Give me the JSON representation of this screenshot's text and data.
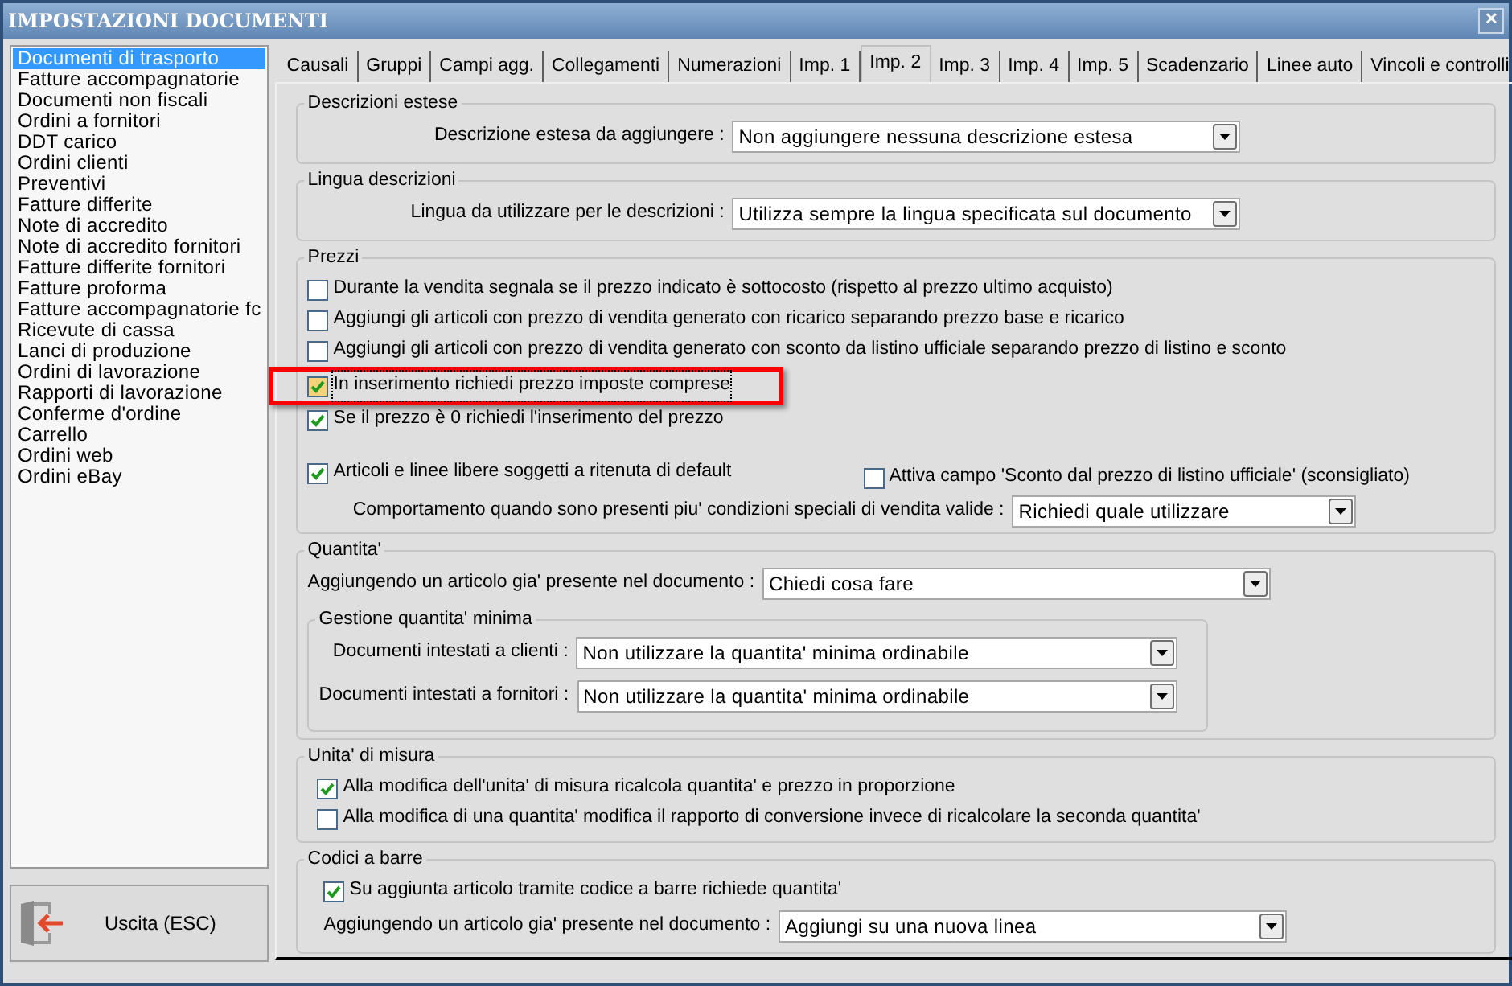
{
  "window": {
    "title": "IMPOSTAZIONI DOCUMENTI",
    "close": "✕"
  },
  "sidebar": {
    "items": [
      {
        "label": "Documenti di trasporto",
        "selected": true
      },
      {
        "label": "Fatture accompagnatorie",
        "selected": false
      },
      {
        "label": "Documenti non fiscali",
        "selected": false
      },
      {
        "label": "Ordini a fornitori",
        "selected": false
      },
      {
        "label": "DDT carico",
        "selected": false
      },
      {
        "label": "Ordini clienti",
        "selected": false
      },
      {
        "label": "Preventivi",
        "selected": false
      },
      {
        "label": "Fatture differite",
        "selected": false
      },
      {
        "label": "Note di accredito",
        "selected": false
      },
      {
        "label": "Note di accredito fornitori",
        "selected": false
      },
      {
        "label": "Fatture differite fornitori",
        "selected": false
      },
      {
        "label": "Fatture proforma",
        "selected": false
      },
      {
        "label": "Fatture accompagnatorie fc",
        "selected": false
      },
      {
        "label": "Ricevute di cassa",
        "selected": false
      },
      {
        "label": "Lanci di produzione",
        "selected": false
      },
      {
        "label": "Ordini di lavorazione",
        "selected": false
      },
      {
        "label": "Rapporti di lavorazione",
        "selected": false
      },
      {
        "label": "Conferme d'ordine",
        "selected": false
      },
      {
        "label": "Carrello",
        "selected": false
      },
      {
        "label": "Ordini web",
        "selected": false
      },
      {
        "label": "Ordini eBay",
        "selected": false
      }
    ]
  },
  "exit_button": {
    "label": "Uscita (ESC)"
  },
  "tabs": [
    {
      "label": "Causali",
      "selected": false
    },
    {
      "label": "Gruppi",
      "selected": false
    },
    {
      "label": "Campi agg.",
      "selected": false
    },
    {
      "label": "Collegamenti",
      "selected": false
    },
    {
      "label": "Numerazioni",
      "selected": false
    },
    {
      "label": "Imp. 1",
      "selected": false
    },
    {
      "label": "Imp. 2",
      "selected": true
    },
    {
      "label": "Imp. 3",
      "selected": false
    },
    {
      "label": "Imp. 4",
      "selected": false
    },
    {
      "label": "Imp. 5",
      "selected": false
    },
    {
      "label": "Scadenzario",
      "selected": false
    },
    {
      "label": "Linee auto",
      "selected": false
    },
    {
      "label": "Vincoli e controlli",
      "selected": false
    }
  ],
  "descrizioni": {
    "title": "Descrizioni estese",
    "label": "Descrizione estesa da aggiungere :",
    "value": "Non aggiungere nessuna descrizione estesa"
  },
  "lingua": {
    "title": "Lingua descrizioni",
    "label": "Lingua da utilizzare per le descrizioni :",
    "value": "Utilizza sempre la lingua specificata sul documento"
  },
  "prezzi": {
    "title": "Prezzi",
    "checks": [
      {
        "label": "Durante la vendita segnala se il prezzo indicato è sottocosto (rispetto al prezzo ultimo acquisto)",
        "checked": false,
        "highlighted": false
      },
      {
        "label": "Aggiungi gli articoli con prezzo di vendita generato con ricarico separando prezzo base e ricarico",
        "checked": false,
        "highlighted": false
      },
      {
        "label": "Aggiungi gli articoli con prezzo di vendita generato con sconto da listino ufficiale separando prezzo di listino e sconto",
        "checked": false,
        "highlighted": false
      },
      {
        "label": "In inserimento richiedi prezzo imposte comprese",
        "checked": true,
        "highlighted": true
      },
      {
        "label": "Se il prezzo è 0 richiedi l'inserimento del prezzo",
        "checked": true,
        "highlighted": false
      }
    ],
    "ritenuta": {
      "label": "Articoli e linee libere soggetti a ritenuta di default",
      "checked": true
    },
    "sconto": {
      "label": "Attiva campo 'Sconto dal prezzo di listino ufficiale' (sconsigliato)",
      "checked": false
    },
    "condizioni": {
      "label": "Comportamento quando sono presenti piu' condizioni speciali di vendita valide :",
      "value": "Richiedi quale utilizzare"
    }
  },
  "quantita": {
    "title": "Quantita'",
    "label": "Aggiungendo un articolo gia' presente nel documento :",
    "value": "Chiedi cosa fare",
    "minima": {
      "title": "Gestione quantita' minima",
      "rows": [
        {
          "label": "Documenti intestati a clienti :",
          "value": "Non utilizzare la quantita' minima ordinabile"
        },
        {
          "label": "Documenti intestati a fornitori :",
          "value": "Non utilizzare la quantita' minima ordinabile"
        }
      ]
    }
  },
  "unita": {
    "title": "Unita' di misura",
    "checks": [
      {
        "label": "Alla modifica dell'unita' di misura ricalcola quantita' e prezzo in proporzione",
        "checked": true
      },
      {
        "label": "Alla modifica di una quantita' modifica il rapporto di conversione invece di ricalcolare la seconda quantita'",
        "checked": false
      }
    ]
  },
  "codici": {
    "title": "Codici a barre",
    "check": {
      "label": "Su aggiunta articolo tramite codice a barre richiede quantita'",
      "checked": true
    },
    "label": "Aggiungendo un articolo gia' presente nel documento :",
    "value": "Aggiungi su una nuova linea"
  }
}
